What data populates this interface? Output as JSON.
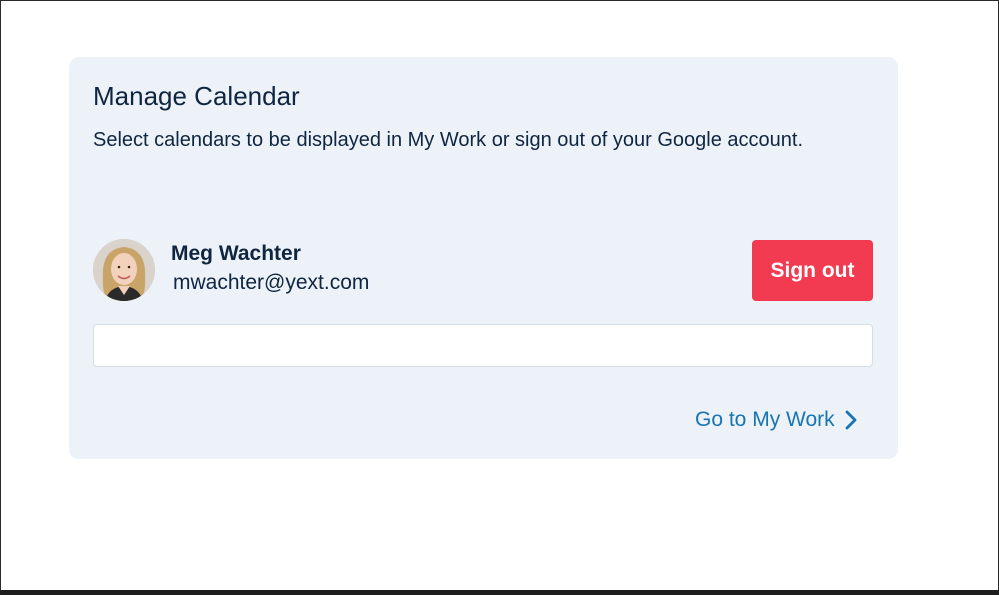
{
  "card": {
    "title": "Manage Calendar",
    "description": "Select calendars to be displayed in My Work or sign out of your Google account."
  },
  "account": {
    "name": "Meg Wachter",
    "email": "mwachter@yext.com",
    "avatar_icon": "user-photo"
  },
  "actions": {
    "sign_out_label": "Sign out",
    "go_to_my_work_label": "Go to My Work",
    "go_to_my_work_icon": "chevron-right-icon"
  },
  "colors": {
    "card_background": "#edf2f9",
    "sign_out_button": "#f23a50",
    "link": "#1775b0",
    "text_primary": "#0f2540"
  }
}
